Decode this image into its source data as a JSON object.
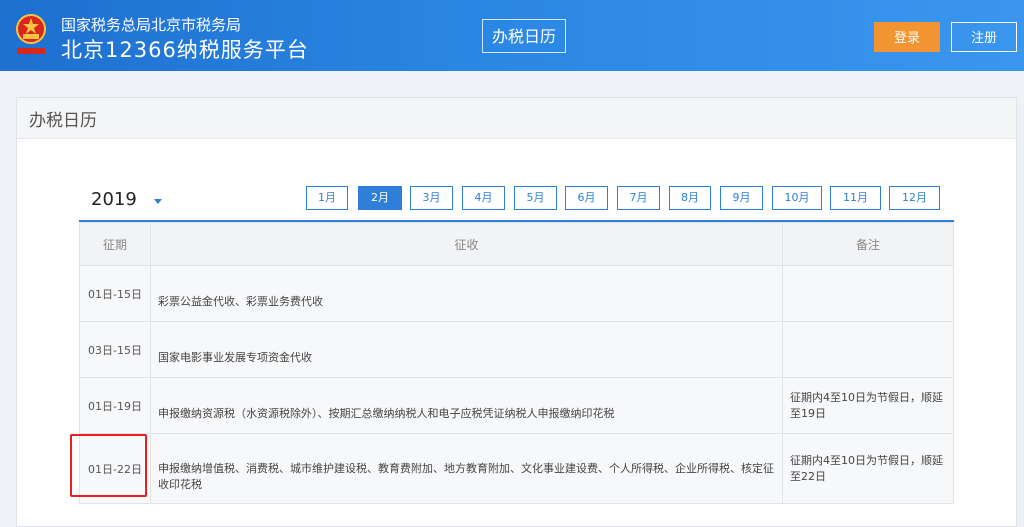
{
  "header": {
    "org": "国家税务总局北京市税务局",
    "site_name": "北京12366纳税服务平台",
    "page_label": "办税日历",
    "login_label": "登录",
    "register_label": "注册",
    "emblem_icon": "national-emblem-icon",
    "brand_color": "#2a86e3",
    "login_color": "#f39432"
  },
  "panel": {
    "title": "办税日历"
  },
  "calendar": {
    "year": "2019",
    "months": [
      "1月",
      "2月",
      "3月",
      "4月",
      "5月",
      "6月",
      "7月",
      "8月",
      "9月",
      "10月",
      "11月",
      "12月"
    ],
    "selected_month": "2月",
    "columns": [
      "征期",
      "征收",
      "备注"
    ],
    "rows": [
      {
        "period": "01日-15日",
        "content": "彩票公益金代收、彩票业务费代收",
        "note": ""
      },
      {
        "period": "03日-15日",
        "content": "国家电影事业发展专项资金代收",
        "note": ""
      },
      {
        "period": "01日-19日",
        "content": "申报缴纳资源税（水资源税除外）、按期汇总缴纳纳税人和电子应税凭证纳税人申报缴纳印花税",
        "note": "征期内4至10日为节假日，顺延至19日"
      },
      {
        "period": "01日-22日",
        "content": "申报缴纳增值税、消费税、城市维护建设税、教育费附加、地方教育附加、文化事业建设费、个人所得税、企业所得税、核定征收印花税",
        "note": "征期内4至10日为节假日，顺延至22日"
      }
    ]
  }
}
